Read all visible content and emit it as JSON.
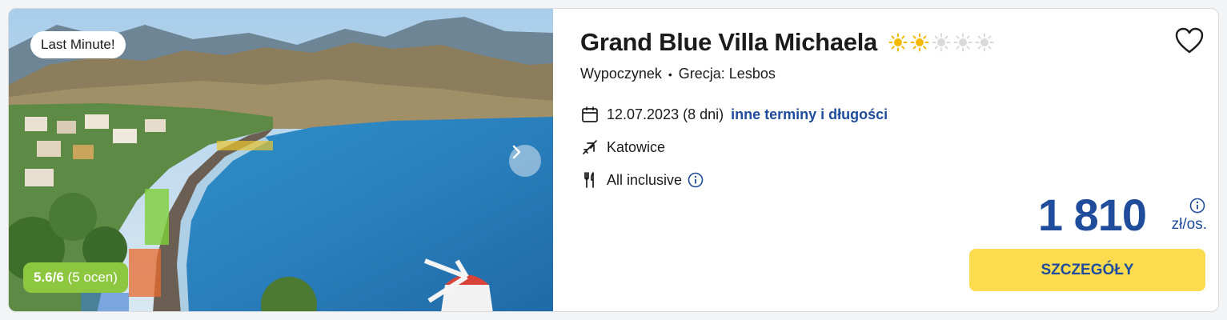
{
  "photo": {
    "badge": "Last Minute!",
    "rating": {
      "score": "5.6/6",
      "count": "(5 ocen)"
    },
    "next_icon": "chevron-right-icon"
  },
  "hotel": {
    "name": "Grand Blue Villa Michaela",
    "category_suns": 2,
    "category_max": 5,
    "location": {
      "type": "Wypoczynek",
      "separator": "•",
      "place": "Grecja: Lesbos"
    },
    "favorite_icon": "heart-outline-icon"
  },
  "trip": {
    "date": "12.07.2023 (8 dni)",
    "other_dates_link": "inne terminy i długości",
    "departure": "Katowice",
    "board": "All inclusive"
  },
  "price": {
    "amount": "1 810",
    "unit": "zł/os."
  },
  "cta": {
    "label": "SZCZEGÓŁY"
  },
  "colors": {
    "brand_blue": "#1f4d9c",
    "cta_yellow": "#fcdc4e",
    "rating_green": "#8dc63f",
    "sun_active": "#f5b800",
    "sun_inactive": "#d9d9d9"
  }
}
